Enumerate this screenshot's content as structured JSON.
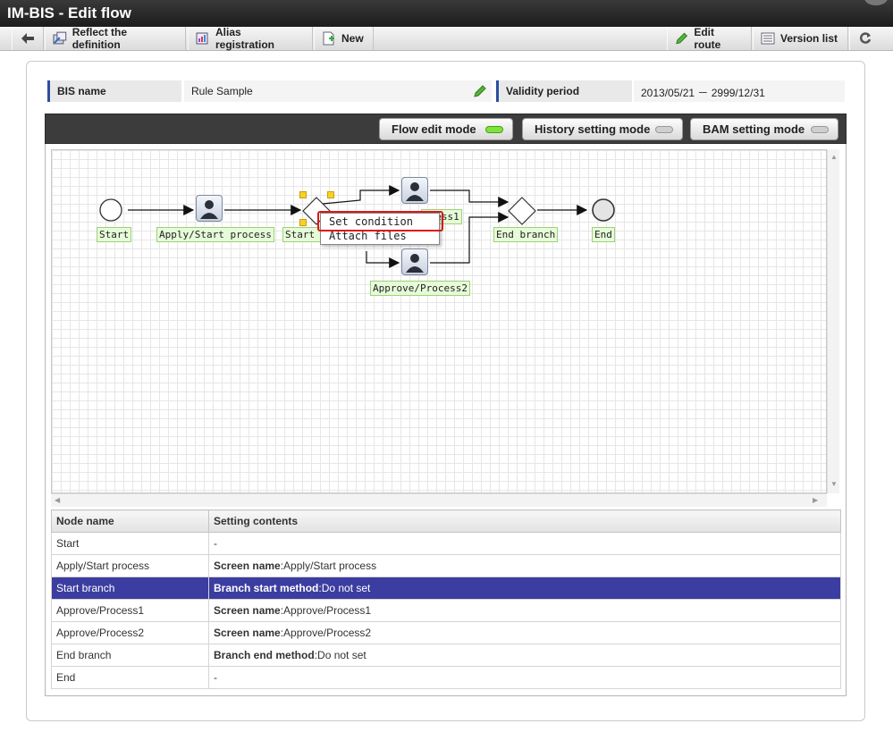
{
  "app": {
    "title": "IM-BIS - Edit flow"
  },
  "toolbar": {
    "back_icon": "back-arrow-icon",
    "reflect_label": "Reflect the definition",
    "alias_label": "Alias registration",
    "new_label": "New",
    "edit_route_label": "Edit route",
    "version_list_label": "Version list",
    "refresh_icon": "refresh-icon"
  },
  "info": {
    "bis_name_label": "BIS name",
    "bis_name_value": "Rule Sample",
    "validity_label": "Validity period",
    "validity_value": "2013/05/21 － 2999/12/31"
  },
  "modes": [
    {
      "label": "Flow edit mode",
      "active": true
    },
    {
      "label": "History setting mode",
      "active": false
    },
    {
      "label": "BAM setting mode",
      "active": false
    }
  ],
  "flow": {
    "nodes": {
      "start": "Start",
      "apply": "Apply/Start process",
      "start_branch": "Start b",
      "approve1": "ocess1",
      "approve2": "Approve/Process2",
      "end_branch": "End branch",
      "end": "End"
    },
    "context_menu": [
      "Set condition",
      "Attach files"
    ]
  },
  "table": {
    "headers": [
      "Node name",
      "Setting contents"
    ],
    "rows": [
      {
        "node": "Start",
        "key": "",
        "value": "-"
      },
      {
        "node": "Apply/Start process",
        "key": "Screen name",
        "value": ":Apply/Start process"
      },
      {
        "node": "Start branch",
        "key": "Branch start method",
        "value": ":Do not set",
        "selected": true
      },
      {
        "node": "Approve/Process1",
        "key": "Screen name",
        "value": ":Approve/Process1"
      },
      {
        "node": "Approve/Process2",
        "key": "Screen name",
        "value": ":Approve/Process2"
      },
      {
        "node": "End branch",
        "key": "Branch end method",
        "value": ":Do not set"
      },
      {
        "node": "End",
        "key": "",
        "value": "-"
      }
    ]
  },
  "colors": {
    "selected_row": "#3b3da0",
    "active_lamp": "#7ee33a",
    "highlight": "#d81818"
  }
}
